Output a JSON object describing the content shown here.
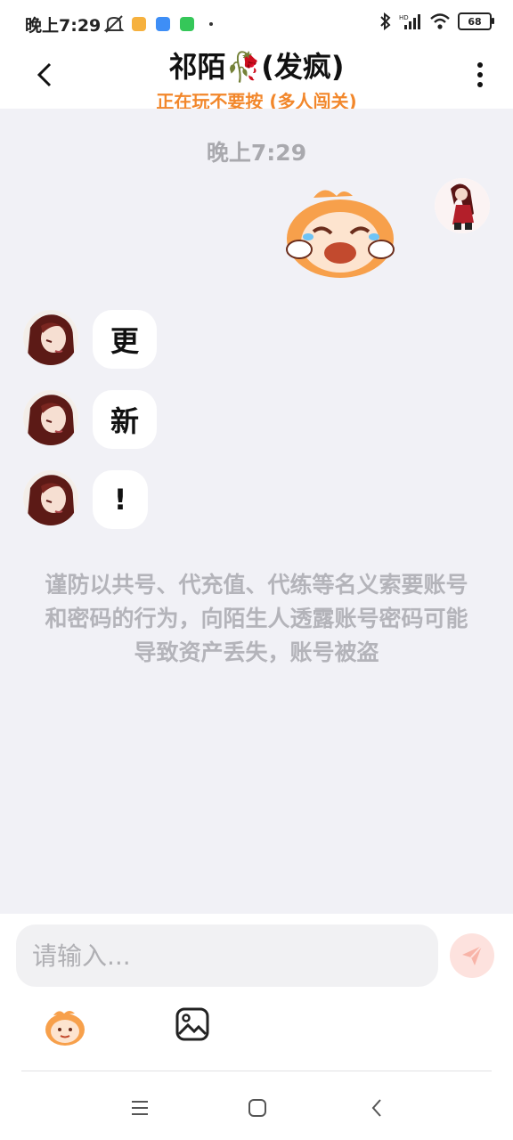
{
  "status_bar": {
    "time": "晚上7:29",
    "battery": "68",
    "icons": [
      "mute-icon",
      "app-notification-icon",
      "browser-icon",
      "message-icon",
      "bluetooth-icon",
      "signal-icon",
      "wifi-icon",
      "battery-icon"
    ]
  },
  "header": {
    "title": "祁陌🥀(发疯)",
    "subtitle": "正在玩不要按 (多人闯关)"
  },
  "chat": {
    "timestamp": "晚上7:29",
    "messages": [
      {
        "sender": "self",
        "type": "sticker",
        "icon": "crying-sticker-icon"
      },
      {
        "sender": "other",
        "type": "text",
        "text": "更"
      },
      {
        "sender": "other",
        "type": "text",
        "text": "新"
      },
      {
        "sender": "other",
        "type": "text",
        "text": "!"
      }
    ],
    "notice": "谨防以共号、代充值、代练等名义索要账号和密码的行为，向陌生人透露账号密码可能导致资产丢失，账号被盗"
  },
  "input": {
    "placeholder": "请输入..."
  },
  "colors": {
    "accent": "#f2872b",
    "chat_bg": "#f1f1f6",
    "send_bg": "#fde2de",
    "send_icon": "#f8b4a8"
  }
}
